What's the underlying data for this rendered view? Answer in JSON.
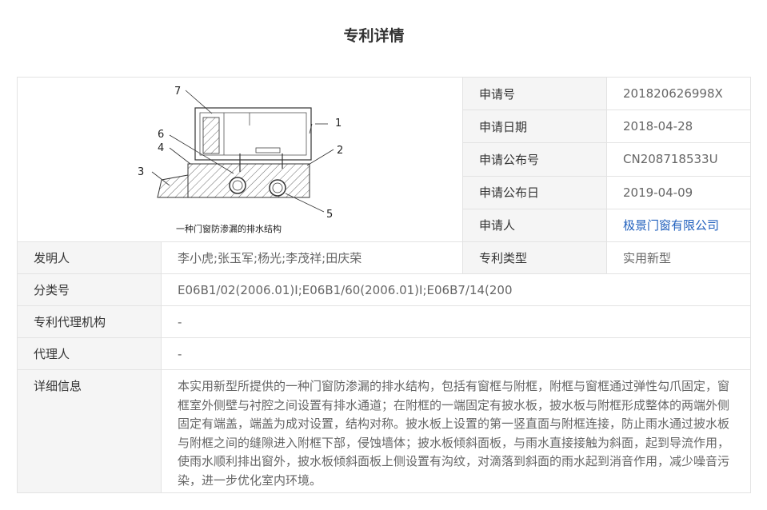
{
  "page": {
    "title": "专利详情"
  },
  "figure": {
    "caption": "一种门窗防渗漏的排水结构",
    "callouts": [
      "7",
      "6",
      "4",
      "3",
      "1",
      "2",
      "5"
    ]
  },
  "right_fields": [
    {
      "label": "申请号",
      "value": "201820626998X"
    },
    {
      "label": "申请日期",
      "value": "2018-04-28"
    },
    {
      "label": "申请公布号",
      "value": "CN208718533U"
    },
    {
      "label": "申请公布日",
      "value": "2019-04-09"
    },
    {
      "label": "申请人",
      "value": "极景门窗有限公司"
    }
  ],
  "inventor": {
    "label": "发明人",
    "value": "李小虎;张玉军;杨光;李茂祥;田庆荣"
  },
  "patent_type": {
    "label": "专利类型",
    "value": "实用新型"
  },
  "classification": {
    "label": "分类号",
    "value": "E06B1/02(2006.01)I;E06B1/60(2006.01)I;E06B7/14(200"
  },
  "agency": {
    "label": "专利代理机构",
    "value": "-"
  },
  "agent": {
    "label": "代理人",
    "value": "-"
  },
  "details": {
    "label": "详细信息",
    "value": "本实用新型所提供的一种门窗防渗漏的排水结构，包括有窗框与附框，附框与窗框通过弹性勾爪固定，窗框室外侧壁与衬腔之间设置有排水通道；在附框的一端固定有披水板，披水板与附框形成整体的两端外侧固定有端盖，端盖为成对设置，结构对称。披水板上设置的第一竖直面与附框连接，防止雨水通过披水板与附框之间的缝隙进入附框下部，侵蚀墙体；披水板倾斜面板，与雨水直接接触为斜面，起到导流作用，使雨水顺利排出窗外，披水板倾斜面板上侧设置有沟纹，对滴落到斜面的雨水起到消音作用，减少噪音污染，进一步优化室内环境。"
  },
  "colors": {
    "label_bg": "#f5f5f5",
    "border": "#e3e3e3",
    "link": "#1f5fbd"
  }
}
